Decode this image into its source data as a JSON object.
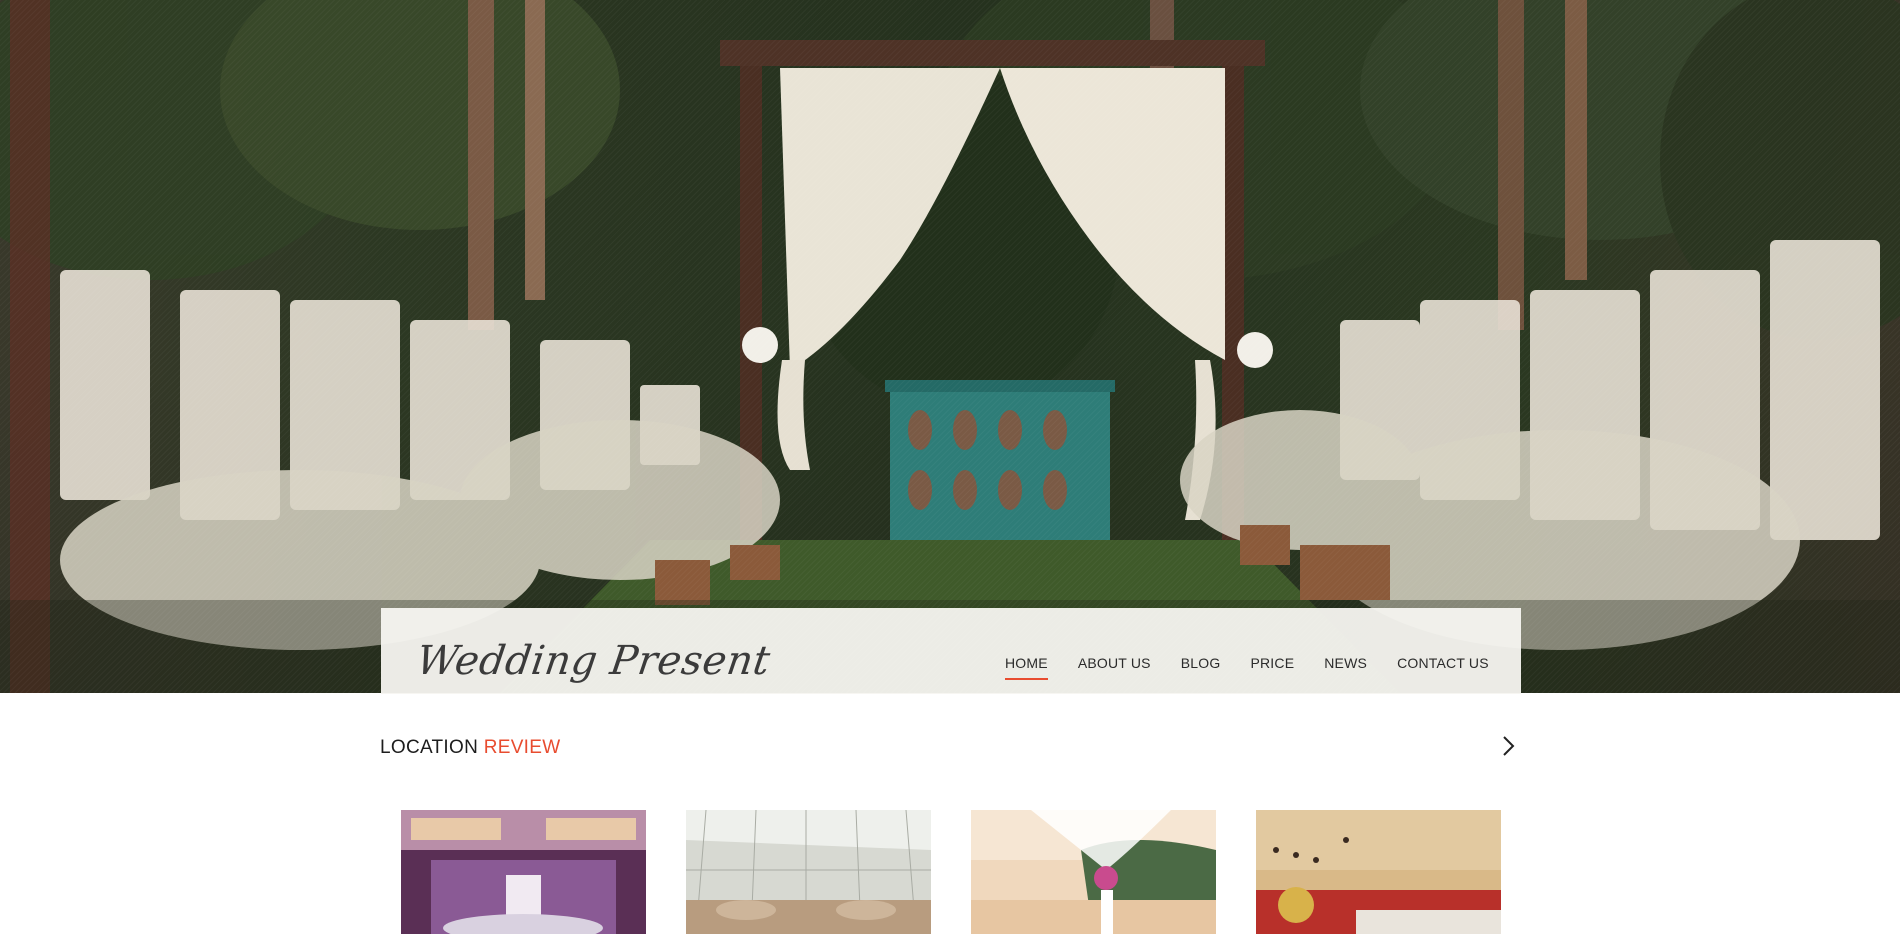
{
  "site": {
    "logo_text": "Wedding Present"
  },
  "nav": {
    "items": [
      {
        "label": "HOME",
        "active": true
      },
      {
        "label": "ABOUT US",
        "active": false
      },
      {
        "label": "BLOG",
        "active": false
      },
      {
        "label": "PRICE",
        "active": false
      },
      {
        "label": "NEWS",
        "active": false
      },
      {
        "label": "CONTACT US",
        "active": false
      }
    ]
  },
  "location_review": {
    "title_part1": "LOCATION",
    "title_part2": "REVIEW",
    "next_icon": "chevron-right-icon"
  },
  "colors": {
    "accent": "#e84c2f",
    "navbar_bg": "#f7f5f1",
    "text_dark": "#1d1d1d"
  }
}
